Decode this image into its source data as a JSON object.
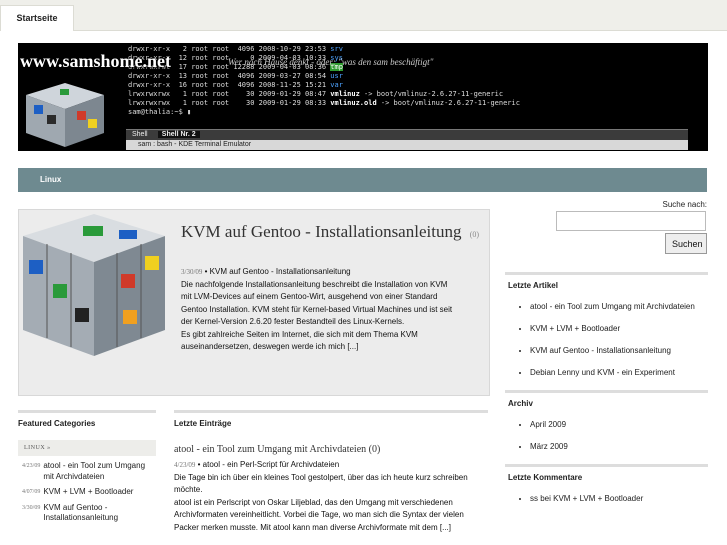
{
  "topbar": {
    "home_tab": "Startseite"
  },
  "banner": {
    "site_name": "www.samshome.net",
    "tagline": "Wer nach Hause denkt - oder: \"was den sam beschäftigt\"",
    "terminal_lines": [
      {
        "text": "drwxr-xr-x   2 root root  4096 2008-10-29 23:53 ",
        "name": "srv"
      },
      {
        "text": "drwxr-xr-x  12 root root     0 2009-04-03 10:33 ",
        "name": "sys"
      },
      {
        "text": "drwxrwxrwt  17 root root 12288 2009-04-03 08:36 ",
        "name": "tmp"
      },
      {
        "text": "drwxr-xr-x  13 root root  4096 2009-03-27 08:54 ",
        "name": "usr"
      },
      {
        "text": "drwxr-xr-x  16 root root  4096 2008-11-25 15:21 ",
        "name": "var"
      },
      {
        "text": "lrwxrwxrwx   1 root root    30 2009-01-29 08:47 ",
        "name": "vmlinuz",
        "target": " -> boot/vmlinuz-2.6.27-11-generic"
      },
      {
        "text": "lrwxrwxrwx   1 root root    30 2009-01-29 08:33 ",
        "name": "vmlinuz.old",
        "target": " -> boot/vmlinuz-2.6.27-11-generic"
      },
      {
        "text": "sam@thalia:~$ ",
        "name": ""
      }
    ],
    "terminal_tabs": [
      "Shell",
      "Shell Nr. 2"
    ],
    "terminal_title": "sam : bash - KDE Terminal Emulator"
  },
  "nav": {
    "item": "Linux"
  },
  "search": {
    "label": "Suche nach:",
    "button": "Suchen",
    "value": ""
  },
  "featured": {
    "title": "KVM auf Gentoo - Installationsanleitung",
    "comments": "(0)",
    "date": "3/30/09",
    "subtitle": "KVM auf Gentoo - Installationsanleitung",
    "body": "Die nachfolgende Installationsanleitung beschreibt die Installation von KVM mit LVM-Devices auf einem Gentoo-Wirt, ausgehend von einer Standard Gentoo Installation. KVM steht für Kernel-based Virtual Machines und ist seit der Kernel-Version 2.6.20 fester Bestandteil des Linux-Kernels.",
    "body2": "Es gibt zahlreiche Seiten im Internet, die sich mit dem Thema KVM auseinandersetzen, deswegen werde ich mich [...]"
  },
  "featured_categories": {
    "heading": "Featured Categories",
    "category": "LINUX »",
    "items": [
      {
        "date": "4/23/09",
        "title": "atool - ein Tool zum Umgang mit Archivdateien"
      },
      {
        "date": "4/07/09",
        "title": "KVM + LVM + Bootloader"
      },
      {
        "date": "3/30/09",
        "title": "KVM auf Gentoo - Installationsanleitung"
      }
    ]
  },
  "latest": {
    "heading": "Letzte Einträge",
    "entry_title": "atool - ein Tool zum Umgang mit Archivdateien",
    "entry_comments": "(0)",
    "date": "4/23/09",
    "subtitle": "atool - ein Perl-Script für Archivdateien",
    "body": "Die Tage bin ich über ein kleines Tool gestolpert, über das ich heute kurz schreiben möchte.",
    "body2": "atool ist ein Perlscript von Oskar Liljeblad, das den Umgang mit verschiedenen Archivformaten vereinheitlicht. Vorbei die Tage, wo man sich die Syntax der vielen Packer merken musste. Mit atool kann man diverse Archivformate mit dem [...]"
  },
  "sidebar": {
    "recent_heading": "Letzte Artikel",
    "recent": [
      "atool - ein Tool zum Umgang mit Archivdateien",
      "KVM + LVM + Bootloader",
      "KVM auf Gentoo - Installationsanleitung",
      "Debian Lenny und KVM - ein Experiment"
    ],
    "archive_heading": "Archiv",
    "archive": [
      "April 2009",
      "März 2009"
    ],
    "comments_heading": "Letzte Kommentare",
    "comments": [
      "ss bei KVM + LVM + Bootloader"
    ]
  }
}
